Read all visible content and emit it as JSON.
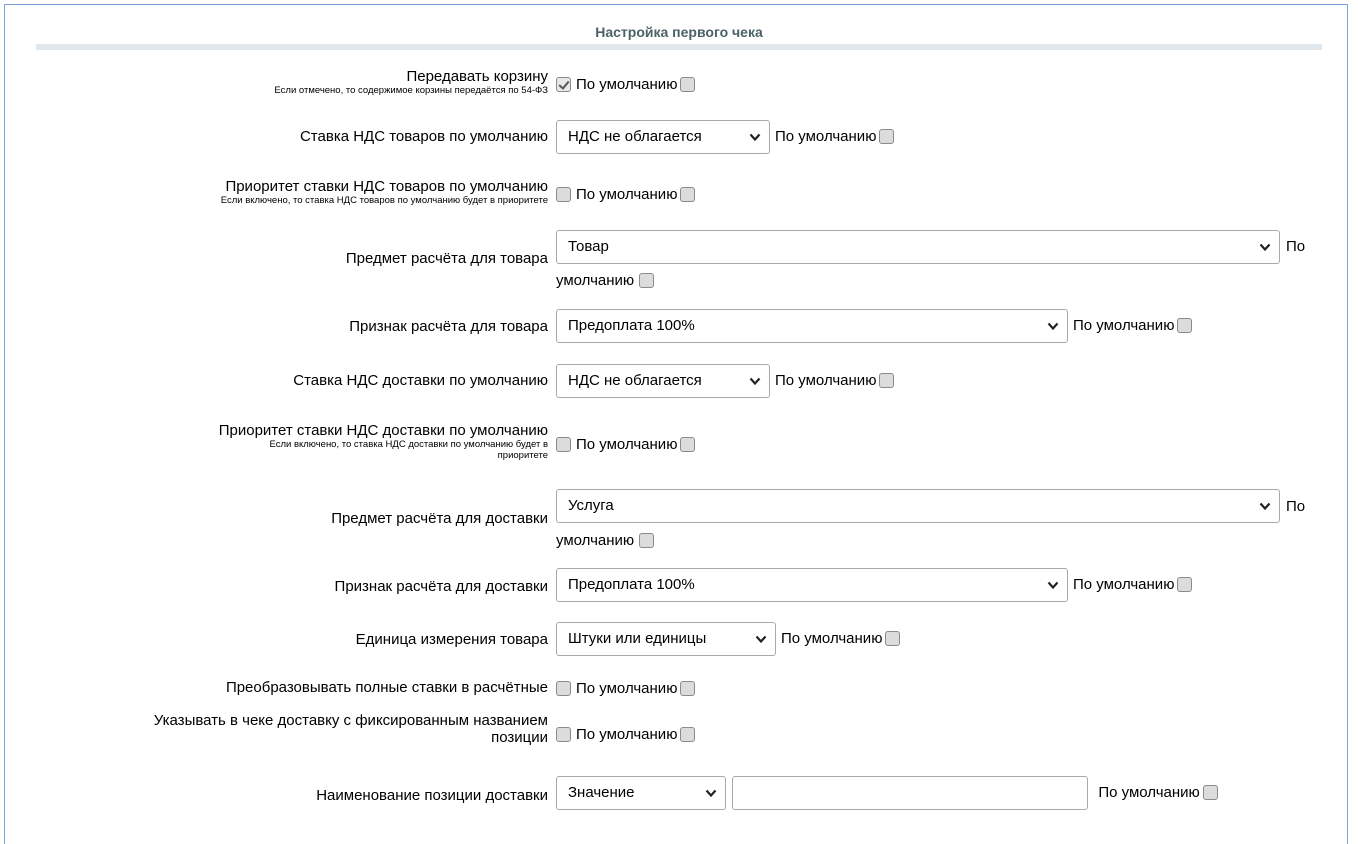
{
  "section": {
    "title": "Настройка первого чека"
  },
  "default_label": "По умолчанию",
  "default_label_part1": "По",
  "default_label_part2": "умолчанию",
  "rows": {
    "cart": {
      "label": "Передавать корзину",
      "hint": "Если отмечено, то содержимое корзины передаётся по 54-ФЗ",
      "checked": true
    },
    "vat_goods": {
      "label": "Ставка НДС товаров по умолчанию",
      "value": "НДС не облагается"
    },
    "vat_goods_priority": {
      "label": "Приоритет ставки НДС товаров по умолчанию",
      "hint": "Если включено, то ставка НДС товаров по умолчанию будет в приоритете"
    },
    "subject_goods": {
      "label": "Предмет расчёта для товара",
      "value": "Товар"
    },
    "method_goods": {
      "label": "Признак расчёта для товара",
      "value": "Предоплата 100%"
    },
    "vat_delivery": {
      "label": "Ставка НДС доставки по умолчанию",
      "value": "НДС не облагается"
    },
    "vat_delivery_priority": {
      "label": "Приоритет ставки НДС доставки по умолчанию",
      "hint1": "Если включено, то ставка НДС доставки по умолчанию будет в",
      "hint2": "приоритете"
    },
    "subject_delivery": {
      "label": "Предмет расчёта для доставки",
      "value": "Услуга"
    },
    "method_delivery": {
      "label": "Признак расчёта для доставки",
      "value": "Предоплата 100%"
    },
    "unit": {
      "label": "Единица измерения товара",
      "value": "Штуки или единицы"
    },
    "convert_rates": {
      "label": "Преобразовывать полные ставки в расчётные"
    },
    "fixed_delivery": {
      "label1": "Указывать в чеке доставку с фиксированным названием",
      "label2": "позиции"
    },
    "delivery_name": {
      "label": "Наименование позиции доставки",
      "value": "Значение",
      "input_value": ""
    }
  },
  "icons": {
    "checkbox": "checkbox-icon",
    "dropdown": "chevron-down-icon"
  },
  "colors": {
    "frame_border": "#7aa4d8",
    "title_text": "#4b6267",
    "title_rule": "#e0e8ed"
  }
}
